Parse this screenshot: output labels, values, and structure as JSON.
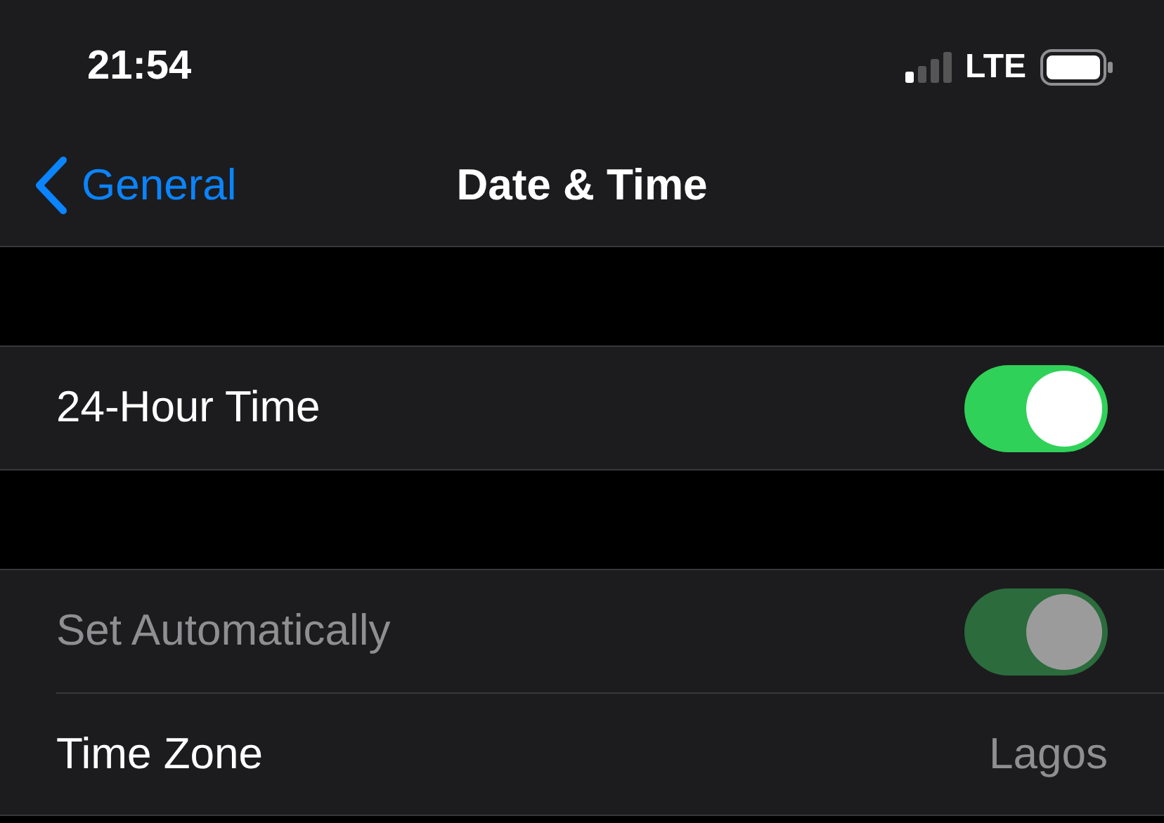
{
  "status_bar": {
    "time": "21:54",
    "network": "LTE"
  },
  "nav": {
    "back": "General",
    "title": "Date & Time"
  },
  "sections": [
    {
      "rows": [
        {
          "kind": "toggle",
          "label": "24-Hour Time",
          "on": true,
          "disabled": false
        }
      ]
    },
    {
      "rows": [
        {
          "kind": "toggle",
          "label": "Set Automatically",
          "on": true,
          "disabled": true
        },
        {
          "kind": "value",
          "label": "Time Zone",
          "value": "Lagos"
        }
      ]
    }
  ]
}
